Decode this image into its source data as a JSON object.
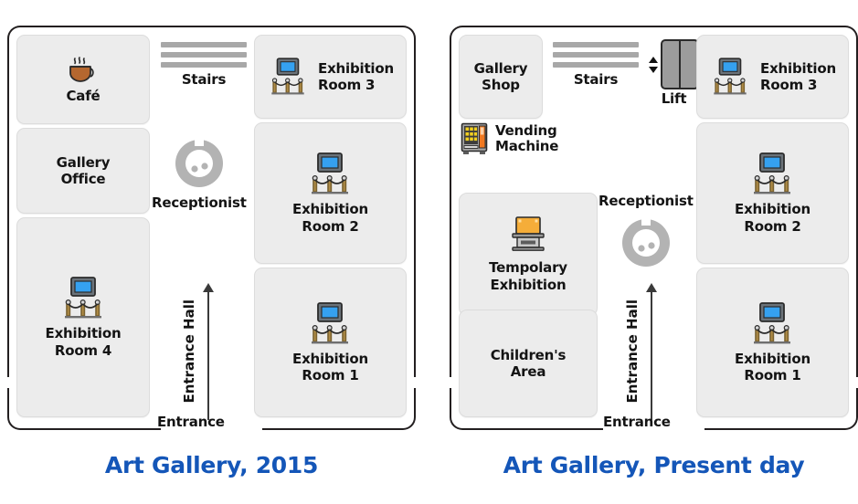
{
  "panels": [
    {
      "id": "gallery-2015",
      "caption": "Art Gallery, 2015",
      "entrance_label": "Entrance",
      "hall_label": "Entrance Hall",
      "rooms": [
        {
          "name": "cafe",
          "label": "Café",
          "icon": "coffee-cup-icon",
          "layout": "vertical"
        },
        {
          "name": "gallery-office",
          "label": "Gallery\nOffice",
          "icon": "none",
          "layout": "vertical"
        },
        {
          "name": "exhibition-room-4",
          "label": "Exhibition\nRoom 4",
          "icon": "framed-painting-icon",
          "layout": "vertical"
        },
        {
          "name": "exhibition-room-3",
          "label": "Exhibition\nRoom 3",
          "icon": "framed-painting-icon",
          "layout": "horizontal"
        },
        {
          "name": "exhibition-room-2",
          "label": "Exhibition\nRoom 2",
          "icon": "framed-painting-icon",
          "layout": "vertical"
        },
        {
          "name": "exhibition-room-1",
          "label": "Exhibition\nRoom 1",
          "icon": "framed-painting-icon",
          "layout": "vertical"
        }
      ],
      "features": [
        {
          "name": "stairs",
          "label": "Stairs",
          "icon": "stairs-icon"
        },
        {
          "name": "receptionist",
          "label": "Receptionist",
          "icon": "reception-desk-icon"
        }
      ]
    },
    {
      "id": "gallery-present-day",
      "caption": "Art Gallery, Present day",
      "entrance_label": "Entrance",
      "hall_label": "Entrance Hall",
      "rooms": [
        {
          "name": "gallery-shop",
          "label": "Gallery\nShop",
          "icon": "none",
          "layout": "vertical"
        },
        {
          "name": "tempolary-exhibition",
          "label": "Tempolary\nExhibition",
          "icon": "display-stand-icon",
          "layout": "vertical"
        },
        {
          "name": "childrens-area",
          "label": "Children's\nArea",
          "icon": "none",
          "layout": "vertical"
        },
        {
          "name": "exhibition-room-3",
          "label": "Exhibition\nRoom 3",
          "icon": "framed-painting-icon",
          "layout": "horizontal"
        },
        {
          "name": "exhibition-room-2",
          "label": "Exhibition\nRoom 2",
          "icon": "framed-painting-icon",
          "layout": "vertical"
        },
        {
          "name": "exhibition-room-1",
          "label": "Exhibition\nRoom 1",
          "icon": "framed-painting-icon",
          "layout": "vertical"
        }
      ],
      "features": [
        {
          "name": "stairs",
          "label": "Stairs",
          "icon": "stairs-icon"
        },
        {
          "name": "lift",
          "label": "Lift",
          "icon": "lift-icon"
        },
        {
          "name": "vending-machine",
          "label": "Vending\nMachine",
          "icon": "vending-machine-icon"
        },
        {
          "name": "receptionist",
          "label": "Receptionist",
          "icon": "reception-desk-icon"
        }
      ]
    }
  ],
  "colors": {
    "caption": "#1456b8",
    "room_fill": "#ececec",
    "room_border": "#dcdcdc",
    "wall": "#231f20",
    "painting_blue": "#35a1f0",
    "stanchion_gold": "#b08c46",
    "cafe_brown": "#b5672f",
    "stand_orange": "#f5ad39",
    "vending_orange": "#f07820",
    "gray_icon": "#b0b0b0"
  }
}
